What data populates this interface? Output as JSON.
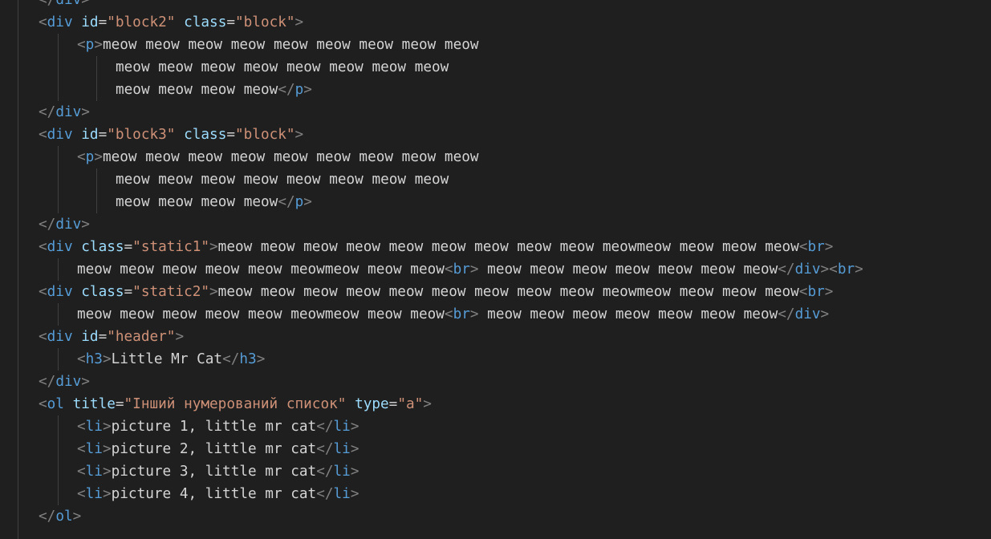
{
  "editor": {
    "language": "html",
    "colors": {
      "background": "#1f1f1f",
      "bracket": "#808080",
      "tag": "#569cd6",
      "attribute": "#9cdcfe",
      "string": "#ce9178",
      "text": "#d4d4d4"
    },
    "lines": [
      [
        {
          "t": "br",
          "v": "</"
        },
        {
          "t": "tg",
          "v": "div"
        },
        {
          "t": "br",
          "v": ">"
        }
      ],
      [
        {
          "t": "br",
          "v": "<"
        },
        {
          "t": "tg",
          "v": "div"
        },
        {
          "t": "tx",
          "v": " "
        },
        {
          "t": "at",
          "v": "id"
        },
        {
          "t": "eq",
          "v": "="
        },
        {
          "t": "st",
          "v": "\"block2\""
        },
        {
          "t": "tx",
          "v": " "
        },
        {
          "t": "at",
          "v": "class"
        },
        {
          "t": "eq",
          "v": "="
        },
        {
          "t": "st",
          "v": "\"block\""
        },
        {
          "t": "br",
          "v": ">"
        }
      ],
      [
        {
          "t": "br",
          "v": "<"
        },
        {
          "t": "tg",
          "v": "p"
        },
        {
          "t": "br",
          "v": ">"
        },
        {
          "t": "tx",
          "v": "meow meow meow meow meow meow meow meow meow"
        }
      ],
      [
        {
          "t": "tx",
          "v": "meow meow meow meow meow meow meow meow"
        }
      ],
      [
        {
          "t": "tx",
          "v": "meow meow meow meow"
        },
        {
          "t": "br",
          "v": "</"
        },
        {
          "t": "tg",
          "v": "p"
        },
        {
          "t": "br",
          "v": ">"
        }
      ],
      [
        {
          "t": "br",
          "v": "</"
        },
        {
          "t": "tg",
          "v": "div"
        },
        {
          "t": "br",
          "v": ">"
        }
      ],
      [
        {
          "t": "br",
          "v": "<"
        },
        {
          "t": "tg",
          "v": "div"
        },
        {
          "t": "tx",
          "v": " "
        },
        {
          "t": "at",
          "v": "id"
        },
        {
          "t": "eq",
          "v": "="
        },
        {
          "t": "st",
          "v": "\"block3\""
        },
        {
          "t": "tx",
          "v": " "
        },
        {
          "t": "at",
          "v": "class"
        },
        {
          "t": "eq",
          "v": "="
        },
        {
          "t": "st",
          "v": "\"block\""
        },
        {
          "t": "br",
          "v": ">"
        }
      ],
      [
        {
          "t": "br",
          "v": "<"
        },
        {
          "t": "tg",
          "v": "p"
        },
        {
          "t": "br",
          "v": ">"
        },
        {
          "t": "tx",
          "v": "meow meow meow meow meow meow meow meow meow"
        }
      ],
      [
        {
          "t": "tx",
          "v": "meow meow meow meow meow meow meow meow"
        }
      ],
      [
        {
          "t": "tx",
          "v": "meow meow meow meow"
        },
        {
          "t": "br",
          "v": "</"
        },
        {
          "t": "tg",
          "v": "p"
        },
        {
          "t": "br",
          "v": ">"
        }
      ],
      [
        {
          "t": "br",
          "v": "</"
        },
        {
          "t": "tg",
          "v": "div"
        },
        {
          "t": "br",
          "v": ">"
        }
      ],
      [
        {
          "t": "br",
          "v": "<"
        },
        {
          "t": "tg",
          "v": "div"
        },
        {
          "t": "tx",
          "v": " "
        },
        {
          "t": "at",
          "v": "class"
        },
        {
          "t": "eq",
          "v": "="
        },
        {
          "t": "st",
          "v": "\"static1\""
        },
        {
          "t": "br",
          "v": ">"
        },
        {
          "t": "tx",
          "v": "meow meow meow meow meow meow meow meow meow meowmeow meow meow meow"
        },
        {
          "t": "br",
          "v": "<"
        },
        {
          "t": "tg",
          "v": "br"
        },
        {
          "t": "br",
          "v": ">"
        }
      ],
      [
        {
          "t": "tx",
          "v": "meow meow meow meow meow meowmeow meow meow"
        },
        {
          "t": "br",
          "v": "<"
        },
        {
          "t": "tg",
          "v": "br"
        },
        {
          "t": "br",
          "v": ">"
        },
        {
          "t": "tx",
          "v": " meow meow meow meow meow meow meow"
        },
        {
          "t": "br",
          "v": "</"
        },
        {
          "t": "tg",
          "v": "div"
        },
        {
          "t": "br",
          "v": ">"
        },
        {
          "t": "br",
          "v": "<"
        },
        {
          "t": "tg",
          "v": "br"
        },
        {
          "t": "br",
          "v": ">"
        }
      ],
      [
        {
          "t": "br",
          "v": "<"
        },
        {
          "t": "tg",
          "v": "div"
        },
        {
          "t": "tx",
          "v": " "
        },
        {
          "t": "at",
          "v": "class"
        },
        {
          "t": "eq",
          "v": "="
        },
        {
          "t": "st",
          "v": "\"static2\""
        },
        {
          "t": "br",
          "v": ">"
        },
        {
          "t": "tx",
          "v": "meow meow meow meow meow meow meow meow meow meowmeow meow meow meow"
        },
        {
          "t": "br",
          "v": "<"
        },
        {
          "t": "tg",
          "v": "br"
        },
        {
          "t": "br",
          "v": ">"
        }
      ],
      [
        {
          "t": "tx",
          "v": "meow meow meow meow meow meowmeow meow meow"
        },
        {
          "t": "br",
          "v": "<"
        },
        {
          "t": "tg",
          "v": "br"
        },
        {
          "t": "br",
          "v": ">"
        },
        {
          "t": "tx",
          "v": " meow meow meow meow meow meow meow"
        },
        {
          "t": "br",
          "v": "</"
        },
        {
          "t": "tg",
          "v": "div"
        },
        {
          "t": "br",
          "v": ">"
        }
      ],
      [
        {
          "t": "br",
          "v": "<"
        },
        {
          "t": "tg",
          "v": "div"
        },
        {
          "t": "tx",
          "v": " "
        },
        {
          "t": "at",
          "v": "id"
        },
        {
          "t": "eq",
          "v": "="
        },
        {
          "t": "st",
          "v": "\"header\""
        },
        {
          "t": "br",
          "v": ">"
        }
      ],
      [
        {
          "t": "br",
          "v": "<"
        },
        {
          "t": "tg",
          "v": "h3"
        },
        {
          "t": "br",
          "v": ">"
        },
        {
          "t": "tx",
          "v": "Little Mr Cat"
        },
        {
          "t": "br",
          "v": "</"
        },
        {
          "t": "tg",
          "v": "h3"
        },
        {
          "t": "br",
          "v": ">"
        }
      ],
      [
        {
          "t": "br",
          "v": "</"
        },
        {
          "t": "tg",
          "v": "div"
        },
        {
          "t": "br",
          "v": ">"
        }
      ],
      [
        {
          "t": "br",
          "v": "<"
        },
        {
          "t": "tg",
          "v": "ol"
        },
        {
          "t": "tx",
          "v": " "
        },
        {
          "t": "at",
          "v": "title"
        },
        {
          "t": "eq",
          "v": "="
        },
        {
          "t": "st",
          "v": "\"Інший нумерований список\""
        },
        {
          "t": "tx",
          "v": " "
        },
        {
          "t": "at",
          "v": "type"
        },
        {
          "t": "eq",
          "v": "="
        },
        {
          "t": "st",
          "v": "\"a\""
        },
        {
          "t": "br",
          "v": ">"
        }
      ],
      [
        {
          "t": "br",
          "v": "<"
        },
        {
          "t": "tg",
          "v": "li"
        },
        {
          "t": "br",
          "v": ">"
        },
        {
          "t": "tx",
          "v": "picture 1, little mr cat"
        },
        {
          "t": "br",
          "v": "</"
        },
        {
          "t": "tg",
          "v": "li"
        },
        {
          "t": "br",
          "v": ">"
        }
      ],
      [
        {
          "t": "br",
          "v": "<"
        },
        {
          "t": "tg",
          "v": "li"
        },
        {
          "t": "br",
          "v": ">"
        },
        {
          "t": "tx",
          "v": "picture 2, little mr cat"
        },
        {
          "t": "br",
          "v": "</"
        },
        {
          "t": "tg",
          "v": "li"
        },
        {
          "t": "br",
          "v": ">"
        }
      ],
      [
        {
          "t": "br",
          "v": "<"
        },
        {
          "t": "tg",
          "v": "li"
        },
        {
          "t": "br",
          "v": ">"
        },
        {
          "t": "tx",
          "v": "picture 3, little mr cat"
        },
        {
          "t": "br",
          "v": "</"
        },
        {
          "t": "tg",
          "v": "li"
        },
        {
          "t": "br",
          "v": ">"
        }
      ],
      [
        {
          "t": "br",
          "v": "<"
        },
        {
          "t": "tg",
          "v": "li"
        },
        {
          "t": "br",
          "v": ">"
        },
        {
          "t": "tx",
          "v": "picture 4, little mr cat"
        },
        {
          "t": "br",
          "v": "</"
        },
        {
          "t": "tg",
          "v": "li"
        },
        {
          "t": "br",
          "v": ">"
        }
      ],
      [
        {
          "t": "br",
          "v": "</"
        },
        {
          "t": "tg",
          "v": "ol"
        },
        {
          "t": "br",
          "v": ">"
        }
      ]
    ]
  }
}
